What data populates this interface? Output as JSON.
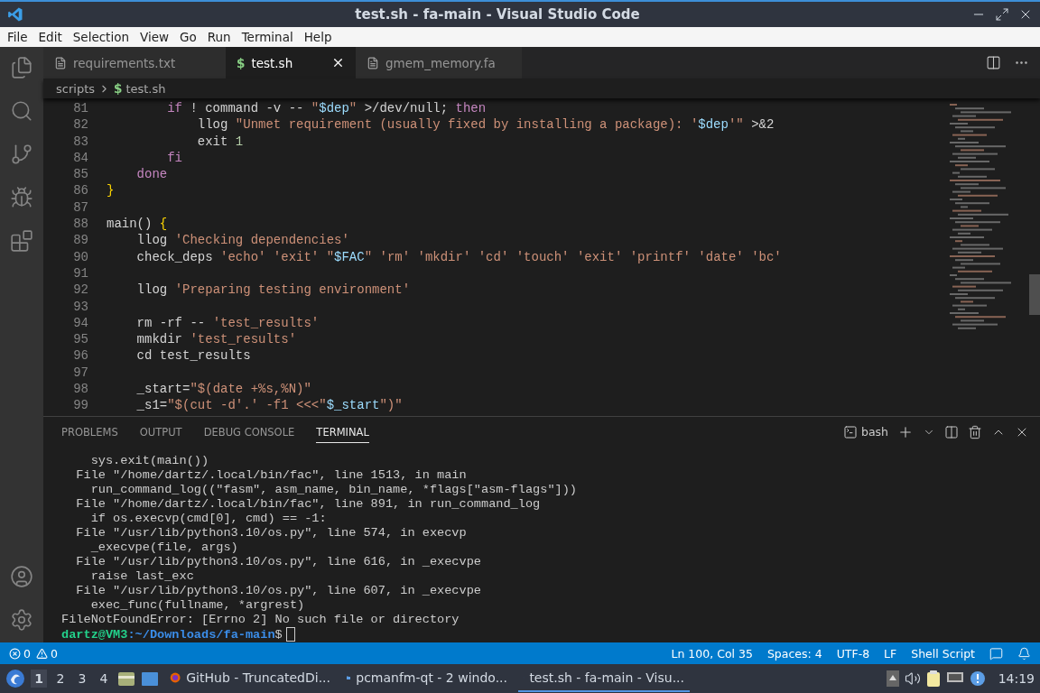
{
  "window": {
    "title": "test.sh - fa-main - Visual Studio Code"
  },
  "menu": [
    "File",
    "Edit",
    "Selection",
    "View",
    "Go",
    "Run",
    "Terminal",
    "Help"
  ],
  "tabs": [
    {
      "label": "requirements.txt",
      "selected": false
    },
    {
      "label": "test.sh",
      "selected": true,
      "glyph": "$"
    },
    {
      "label": "gmem_memory.fa",
      "selected": false
    }
  ],
  "breadcrumb": [
    {
      "label": "scripts"
    },
    {
      "label": "test.sh",
      "glyph": "$"
    }
  ],
  "editor": {
    "lines": [
      {
        "number": "81",
        "segments": [
          {
            "text": "        if",
            "kind": "keyword"
          },
          {
            "text": " ! command -v -- ",
            "kind": "plain"
          },
          {
            "text": "\"",
            "kind": "string"
          },
          {
            "text": "$dep",
            "kind": "variable"
          },
          {
            "text": "\"",
            "kind": "string"
          },
          {
            "text": " >/dev/null; ",
            "kind": "plain"
          },
          {
            "text": "then",
            "kind": "keyword"
          }
        ]
      },
      {
        "number": "82",
        "segments": [
          {
            "text": "            llog ",
            "kind": "plain"
          },
          {
            "text": "\"Unmet requirement (usually fixed by installing a package): '",
            "kind": "string"
          },
          {
            "text": "$dep",
            "kind": "variable"
          },
          {
            "text": "'\"",
            "kind": "string"
          },
          {
            "text": " >&2",
            "kind": "plain"
          }
        ]
      },
      {
        "number": "83",
        "segments": [
          {
            "text": "            exit ",
            "kind": "plain"
          },
          {
            "text": "1",
            "kind": "number"
          }
        ]
      },
      {
        "number": "84",
        "segments": [
          {
            "text": "        fi",
            "kind": "keyword"
          }
        ]
      },
      {
        "number": "85",
        "segments": [
          {
            "text": "    done",
            "kind": "keyword"
          }
        ]
      },
      {
        "number": "86",
        "segments": [
          {
            "text": "}",
            "kind": "brace"
          }
        ]
      },
      {
        "number": "87"
      },
      {
        "number": "88",
        "segments": [
          {
            "text": "main() ",
            "kind": "plain"
          },
          {
            "text": "{",
            "kind": "brace"
          }
        ]
      },
      {
        "number": "89",
        "segments": [
          {
            "text": "    llog ",
            "kind": "plain"
          },
          {
            "text": "'Checking dependencies'",
            "kind": "string"
          }
        ]
      },
      {
        "number": "90",
        "segments": [
          {
            "text": "    check_deps ",
            "kind": "plain"
          },
          {
            "text": "'echo' 'exit' \"",
            "kind": "string"
          },
          {
            "text": "$FAC",
            "kind": "variable"
          },
          {
            "text": "\" 'rm' 'mkdir' 'cd' 'touch' 'exit' 'printf' 'date' 'bc'",
            "kind": "string"
          }
        ]
      },
      {
        "number": "91"
      },
      {
        "number": "92",
        "segments": [
          {
            "text": "    llog ",
            "kind": "plain"
          },
          {
            "text": "'Preparing testing environment'",
            "kind": "string"
          }
        ]
      },
      {
        "number": "93"
      },
      {
        "number": "94",
        "segments": [
          {
            "text": "    rm -rf -- ",
            "kind": "plain"
          },
          {
            "text": "'test_results'",
            "kind": "string"
          }
        ]
      },
      {
        "number": "95",
        "segments": [
          {
            "text": "    mmkdir ",
            "kind": "plain"
          },
          {
            "text": "'test_results'",
            "kind": "string"
          }
        ]
      },
      {
        "number": "96",
        "segments": [
          {
            "text": "    cd test_results",
            "kind": "plain"
          }
        ]
      },
      {
        "number": "97"
      },
      {
        "number": "98",
        "segments": [
          {
            "text": "    _start=",
            "kind": "plain"
          },
          {
            "text": "\"$(date +%s,%N)\"",
            "kind": "string"
          }
        ]
      },
      {
        "number": "99",
        "segments": [
          {
            "text": "    _s1=",
            "kind": "plain"
          },
          {
            "text": "\"$(cut -d'.' -f1 <<<\"",
            "kind": "string"
          },
          {
            "text": "$_start",
            "kind": "variable"
          },
          {
            "text": "\")\"",
            "kind": "string"
          }
        ]
      }
    ]
  },
  "panel": {
    "tabs": [
      {
        "label": "PROBLEMS",
        "selected": false
      },
      {
        "label": "OUTPUT",
        "selected": false
      },
      {
        "label": "DEBUG CONSOLE",
        "selected": false
      },
      {
        "label": "TERMINAL",
        "selected": true
      }
    ],
    "shell": "bash",
    "terminal": [
      "    sys.exit(main())",
      "  File \"/home/dartz/.local/bin/fac\", line 1513, in main",
      "    run_command_log((\"fasm\", asm_name, bin_name, *flags[\"asm-flags\"]))",
      "  File \"/home/dartz/.local/bin/fac\", line 891, in run_command_log",
      "    if os.execvp(cmd[0], cmd) == -1:",
      "  File \"/usr/lib/python3.10/os.py\", line 574, in execvp",
      "    _execvpe(file, args)",
      "  File \"/usr/lib/python3.10/os.py\", line 616, in _execvpe",
      "    raise last_exc",
      "  File \"/usr/lib/python3.10/os.py\", line 607, in _execvpe",
      "    exec_func(fullname, *argrest)",
      "FileNotFoundError: [Errno 2] No such file or directory"
    ],
    "prompt": {
      "user": "dartz@VM3",
      "path": ":~/Downloads/fa-main",
      "symbol": "$"
    }
  },
  "status_bar": {
    "errors": "0",
    "warnings": "0",
    "items": [
      "Ln 100, Col 35",
      "Spaces: 4",
      "UTF-8",
      "LF",
      "Shell Script"
    ]
  },
  "taskbar": {
    "workspaces": [
      {
        "label": "1",
        "selected": true
      },
      {
        "label": "2",
        "selected": false
      },
      {
        "label": "3",
        "selected": false
      },
      {
        "label": "4",
        "selected": false
      }
    ],
    "tasks": [
      {
        "label": "GitHub - TruncatedDi...",
        "kind": "browser",
        "selected": false
      },
      {
        "label": "pcmanfm-qt - 2 windo...",
        "kind": "folder",
        "selected": false
      },
      {
        "label": "test.sh - fa-main - Visu...",
        "kind": "editor",
        "selected": true
      }
    ],
    "time": "14:19"
  }
}
